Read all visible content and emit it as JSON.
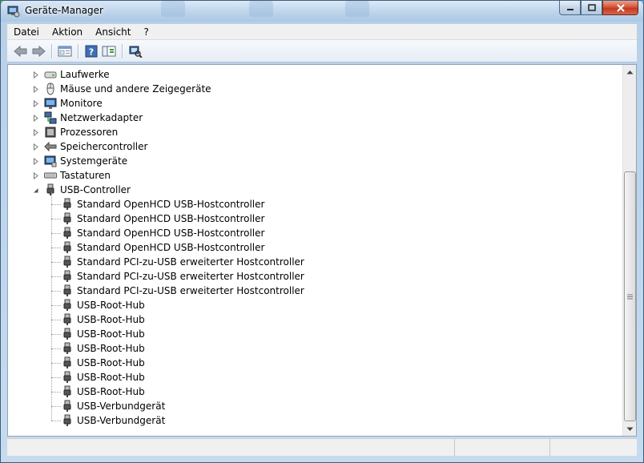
{
  "window": {
    "title": "Geräte-Manager"
  },
  "menu": [
    "Datei",
    "Aktion",
    "Ansicht",
    "?"
  ],
  "toolbar": {
    "icons": [
      "back-arrow-icon",
      "forward-arrow-icon",
      "properties-icon",
      "help-icon",
      "tree-view-icon",
      "scan-hardware-icon"
    ]
  },
  "tree": {
    "categories": [
      {
        "label": "Laufwerke",
        "icon": "drive-icon",
        "expanded": false
      },
      {
        "label": "Mäuse und andere Zeigegeräte",
        "icon": "mouse-icon",
        "expanded": false
      },
      {
        "label": "Monitore",
        "icon": "monitor-icon",
        "expanded": false
      },
      {
        "label": "Netzwerkadapter",
        "icon": "network-icon",
        "expanded": false
      },
      {
        "label": "Prozessoren",
        "icon": "processor-icon",
        "expanded": false
      },
      {
        "label": "Speichercontroller",
        "icon": "storage-controller-icon",
        "expanded": false
      },
      {
        "label": "Systemgeräte",
        "icon": "system-device-icon",
        "expanded": false
      },
      {
        "label": "Tastaturen",
        "icon": "keyboard-icon",
        "expanded": false
      },
      {
        "label": "USB-Controller",
        "icon": "usb-icon",
        "expanded": true
      }
    ],
    "usb_children": [
      "Standard OpenHCD USB-Hostcontroller",
      "Standard OpenHCD USB-Hostcontroller",
      "Standard OpenHCD USB-Hostcontroller",
      "Standard OpenHCD USB-Hostcontroller",
      "Standard PCI-zu-USB erweiterter Hostcontroller",
      "Standard PCI-zu-USB erweiterter Hostcontroller",
      "Standard PCI-zu-USB erweiterter Hostcontroller",
      "USB-Root-Hub",
      "USB-Root-Hub",
      "USB-Root-Hub",
      "USB-Root-Hub",
      "USB-Root-Hub",
      "USB-Root-Hub",
      "USB-Root-Hub",
      "USB-Verbundgerät",
      "USB-Verbundgerät"
    ]
  }
}
